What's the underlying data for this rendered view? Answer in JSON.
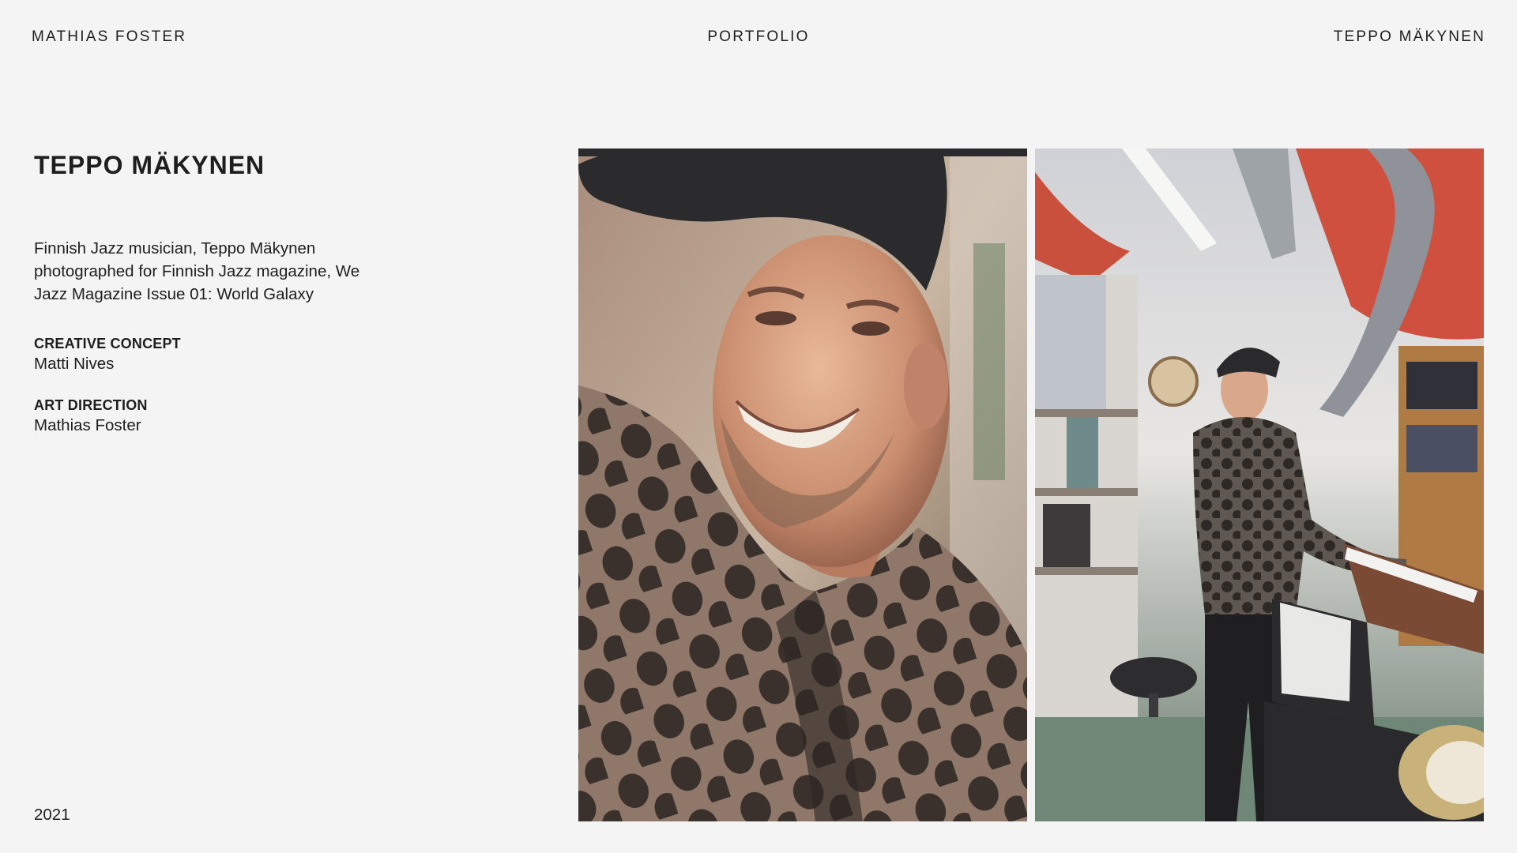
{
  "header": {
    "left_link": "MATHIAS FOSTER",
    "center_link": "PORTFOLIO",
    "right_link": "TEPPO MÄKYNEN"
  },
  "project": {
    "title": "TEPPO MÄKYNEN",
    "description": "Finnish Jazz musician, Teppo Mäkynen photographed for Finnish Jazz magazine, We Jazz Magazine Issue 01: World Galaxy",
    "credits": [
      {
        "label": "CREATIVE CONCEPT",
        "value": "Matti Nives"
      },
      {
        "label": "ART DIRECTION",
        "value": "Mathias Foster"
      }
    ],
    "year": "2021"
  },
  "photos": [
    {
      "subject": "portrait-smiling-in-cap"
    },
    {
      "subject": "musician-at-keyboards-in-studio"
    }
  ],
  "colors": {
    "background": "#f4f4f4",
    "text": "#1e1e1e"
  }
}
